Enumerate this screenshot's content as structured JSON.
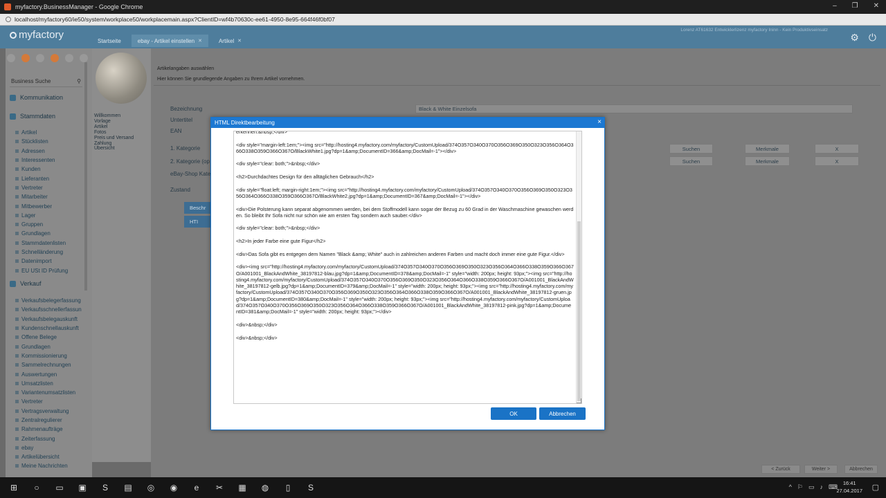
{
  "browser": {
    "window_title": "myfactory.BusinessManager - Google Chrome",
    "url": "localhost/myfactory60/ie50/system/workplace50/workplacemain.aspx?ClientID=wf4b70630c-ee61-4950-8e95-664f46f0bf07"
  },
  "app": {
    "logo": "myfactory",
    "user_info": "Lorenz AT61632 Entwicklerlizenz myfactory Ininn - Kein Produktivseinsatz",
    "tabs": [
      {
        "label": "Startseite"
      },
      {
        "label": "ebay - Artikel einstellen"
      },
      {
        "label": "Artikel"
      }
    ]
  },
  "sidebar": {
    "search_label": "Business Suche",
    "sections": {
      "kommunikation": "Kommunikation",
      "stammdaten": "Stammdaten",
      "verkauf": "Verkauf"
    },
    "stammdaten_items": [
      "Artikel",
      "Stücklisten",
      "Adressen",
      "Interessenten",
      "Kunden",
      "Lieferanten",
      "Vertreter",
      "Mitarbeiter",
      "Mitbewerber",
      "Lager",
      "Gruppen",
      "Grundlagen",
      "Stammdatenlisten",
      "Schnelländerung",
      "Datenimport",
      "EU USt ID Prüfung"
    ],
    "verkauf_items": [
      "Verkaufsbelegerfassung",
      "Verkaufsschnellerfassun",
      "Verkaufsbelegauskunft",
      "Kundenschnellauskunft",
      "Offene Belege",
      "Grundlagen",
      "Kommissionierung",
      "Sammelrechnungen",
      "Auswertungen",
      "Umsatzlisten",
      "Variantenumsatzlisten",
      "Vertreter",
      "Vertragsverwaltung",
      "Zentralregulierer",
      "Rahmenaufträge",
      "Zeiterfassung",
      "ebay",
      "Artikelübersicht",
      "Meine Nachrichten"
    ]
  },
  "wizard": {
    "steps": [
      "Willkommen",
      "Vorlage",
      "Artikel",
      "Fotos",
      "Preis und Versand",
      "Zahlung",
      "Übersicht"
    ]
  },
  "main": {
    "heading": "Artikelangaben auswählen",
    "subheading": "Hier können Sie grundlegende Angaben zu Ihrem Artikel vornehmen.",
    "labels": {
      "bezeichnung": "Bezeichnung",
      "untertitel": "Untertitel",
      "ean": "EAN",
      "kategorie1": "1. Kategorie",
      "kategorie2": "2. Kategorie (op",
      "shop_kategorie": "eBay-Shop Kate",
      "zustand": "Zustand"
    },
    "bezeichnung_value": "Black & White Einzelsofa",
    "buttons": {
      "suchen": "Suchen",
      "merkmale": "Merkmale",
      "remove": "X",
      "beschreibung": "Beschr",
      "html": "HTI"
    },
    "footer": {
      "zurueck": "< Zurück",
      "weiter": "Weiter >",
      "abbrechen": "Abbrechen"
    }
  },
  "modal": {
    "title": "HTML Direktbearbeitung",
    "close": "×",
    "ok_label": "OK",
    "cancel_label": "Abbrechen",
    "lines": [
      "erkennen.&nbsp;</div>",
      "<div style=\"margin-left:1em;\"><img src=\"http://hosting4.myfactory.com/myfactory/CustomUpload/374O357O340O370O356O369O350O323O356O364O366O338O359O366O367O/BlackWhite1.jpg?dp=1&amp;DocumentID=366&amp;DocMail=-1\"></div>",
      "<div style=\"clear: both;\">&nbsp;</div>",
      "<h2>Durchdachtes Design für den alltäglichen Gebrauch</h2>",
      "<div style=\"float:left; margin-right:1em;\"><img src=\"http://hosting4.myfactory.com/myfactory/CustomUpload/374O357O340O370O356O369O350O323O356O364O366O338O359O366O367O/BlackWhite2.jpg?dp=1&amp;DocumentID=367&amp;DocMail=-1\"></div>",
      "<div>Die Polsterung kann separat abgenommen werden, bei dem Stoffmodell kann sogar der Bezug zu 60 Grad in der Waschmaschine gewaschen werden. So bleibt Ihr Sofa nicht nur schön wie am ersten Tag sondern auch sauber.</div>",
      "<div style=\"clear: both;\">&nbsp;</div>",
      "<h2>In jeder Farbe eine gute Figur</h2>",
      "<div>Das Sofa gibt es entgegen dem Namen \"Black &amp; White\" auch in zahlreichen anderen Farben und macht doch immer eine gute Figur.</div>",
      "<div><img src=\"http://hosting4.myfactory.com/myfactory/CustomUpload/374O357O340O370O356O369O350O323O356O364O366O338O359O366O367O/A001001_BlackAndWhite_38197812-blau.jpg?dp=1&amp;DocumentID=378&amp;DocMail=-1\" style=\"width: 200px; height: 93px;\"><img src=\"http://hosting4.myfactory.com/myfactory/CustomUpload/374O357O340O370O356O369O350O323O356O364O366O338O359O366O367O/A001001_BlackAndWhite_38197812-gelb.jpg?dp=1&amp;DocumentID=379&amp;DocMail=-1\" style=\"width: 200px; height: 93px;\"><img src=\"http://hosting4.myfactory.com/myfactory/CustomUpload/374O357O340O370O356O369O350O323O356O364O366O338O359O366O367O/A001001_BlackAndWhite_38197812-gruen.jpg?dp=1&amp;DocumentID=380&amp;DocMail=-1\" style=\"width: 200px; height: 93px;\"><img src=\"http://hosting4.myfactory.com/myfactory/CustomUpload/374O357O340O370O356O369O350O323O356O364O366O338O359O366O367O/A001001_BlackAndWhite_38197812-pink.jpg?dp=1&amp;DocumentID=381&amp;DocMail=-1\" style=\"width: 200px; height: 93px;\"></div>",
      "<div>&nbsp;</div>",
      "<div>&nbsp;</div>"
    ]
  },
  "taskbar": {
    "time": "16:41",
    "date": "27.04.2017"
  },
  "colors": {
    "header": "#4e7d9c",
    "modal_title": "#1c78d2",
    "button": "#1a73c6"
  }
}
